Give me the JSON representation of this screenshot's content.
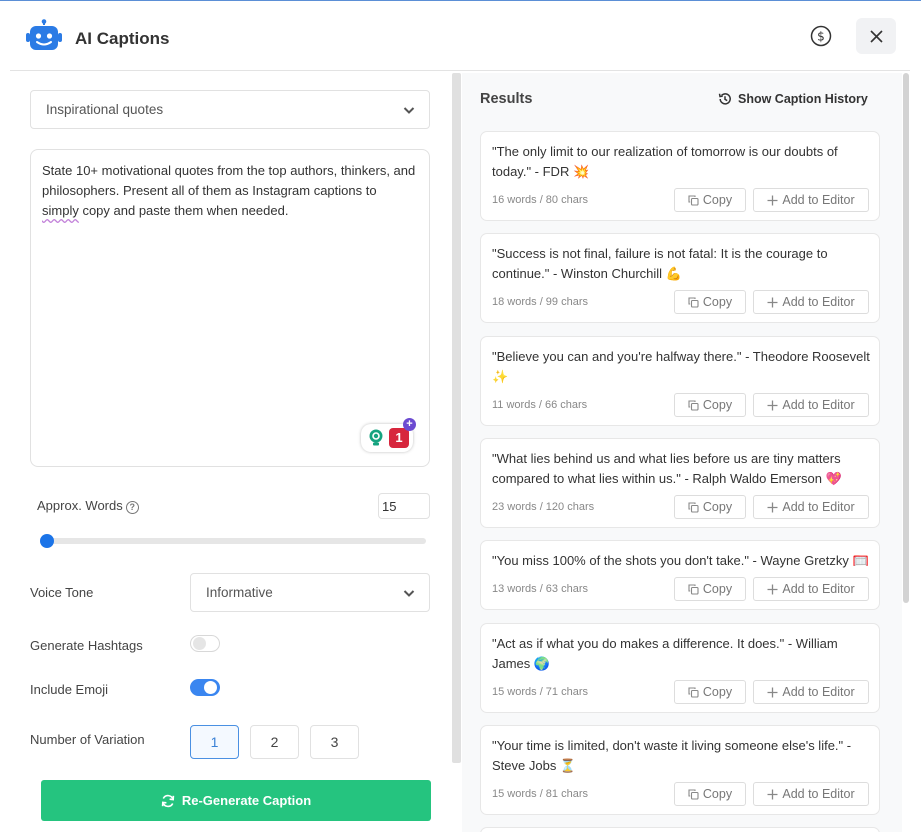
{
  "app": {
    "title": "AI Captions"
  },
  "topic_select": {
    "value": "Inspirational quotes"
  },
  "prompt": {
    "before": "State 10+ motivational quotes from the top authors, thinkers, and philosophers. Present all of them as Instagram captions to ",
    "misspelled": "simply",
    "after": " copy and paste them when needed."
  },
  "grammar_badge": {
    "count": "1"
  },
  "approx_words": {
    "label": "Approx. Words",
    "value": "15"
  },
  "voice_tone": {
    "label": "Voice Tone",
    "value": "Informative"
  },
  "hashtags": {
    "label": "Generate Hashtags",
    "enabled": false
  },
  "emoji": {
    "label": "Include Emoji",
    "enabled": true
  },
  "variations": {
    "label": "Number of Variation",
    "options": [
      "1",
      "2",
      "3"
    ],
    "selected": "1"
  },
  "regenerate_label": "Re-Generate Caption",
  "results": {
    "title": "Results",
    "history_label": "Show Caption History",
    "copy_label": "Copy",
    "add_label": "Add to Editor",
    "captions": [
      {
        "text": "\"The only limit to our realization of tomorrow is our doubts of today.\" - FDR 💥",
        "meta": "16 words / 80 chars"
      },
      {
        "text": "\"Success is not final, failure is not fatal: It is the courage to continue.\" - Winston Churchill 💪",
        "meta": "18 words / 99 chars"
      },
      {
        "text": "\"Believe you can and you're halfway there.\" - Theodore Roosevelt ✨",
        "meta": "11 words / 66 chars"
      },
      {
        "text": "\"What lies behind us and what lies before us are tiny matters compared to what lies within us.\" - Ralph Waldo Emerson 💖",
        "meta": "23 words / 120 chars"
      },
      {
        "text": "\"You miss 100% of the shots you don't take.\" - Wayne Gretzky 🥅",
        "meta": "13 words / 63 chars"
      },
      {
        "text": "\"Act as if what you do makes a difference. It does.\" - William James 🌍",
        "meta": "15 words / 71 chars"
      },
      {
        "text": "\"Your time is limited, don't waste it living someone else's life.\" - Steve Jobs ⏳",
        "meta": "15 words / 81 chars"
      }
    ]
  }
}
